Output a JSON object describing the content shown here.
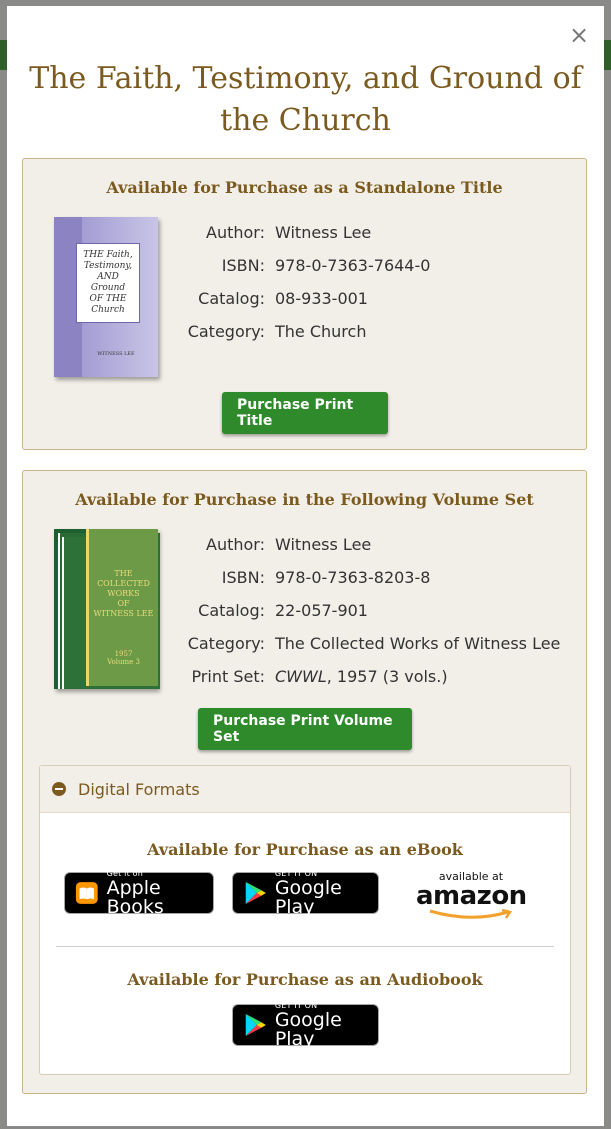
{
  "modal": {
    "close_glyph": "×",
    "title": "The Faith, Testimony, and Ground of the Church"
  },
  "standalone": {
    "heading": "Available for Purchase as a Standalone Title",
    "cover": {
      "title_lines": [
        "THE Faith,",
        "Testimony,",
        "AND Ground",
        "OF THE",
        "Church"
      ],
      "author": "WITNESS LEE"
    },
    "info": [
      {
        "label": "Author:",
        "value": "Witness Lee"
      },
      {
        "label": "ISBN:",
        "value": "978-0-7363-7644-0"
      },
      {
        "label": "Catalog:",
        "value": "08-933-001"
      },
      {
        "label": "Category:",
        "value": "The Church"
      }
    ],
    "button": "Purchase Print Title"
  },
  "volume_set": {
    "heading": "Available for Purchase in the Following Volume Set",
    "cover": {
      "title_lines": [
        "THE",
        "COLLECTED",
        "WORKS",
        "OF",
        "WITNESS LEE"
      ],
      "year": "1957",
      "volume": "Volume 3"
    },
    "info": [
      {
        "label": "Author:",
        "value": "Witness Lee"
      },
      {
        "label": "ISBN:",
        "value": "978-0-7363-8203-8"
      },
      {
        "label": "Catalog:",
        "value": "22-057-901"
      },
      {
        "label": "Category:",
        "value": "The Collected Works of Witness Lee"
      }
    ],
    "print_set": {
      "label": "Print Set:",
      "italic": "CWWL",
      "rest": ", 1957 (3 vols.)"
    },
    "button": "Purchase Print Volume Set"
  },
  "digital": {
    "toggle_label": "Digital Formats",
    "ebook_heading": "Available for Purchase as an eBook",
    "audiobook_heading": "Available for Purchase as an Audiobook",
    "apple": {
      "small": "Get it on",
      "big": "Apple Books"
    },
    "google": {
      "small": "GET IT ON",
      "big": "Google Play"
    },
    "amazon": {
      "small": "available at",
      "big": "amazon"
    }
  },
  "colors": {
    "accent_brown": "#7b5a1f",
    "button_green": "#2e8a2a",
    "panel_bg": "#f2efe8"
  }
}
